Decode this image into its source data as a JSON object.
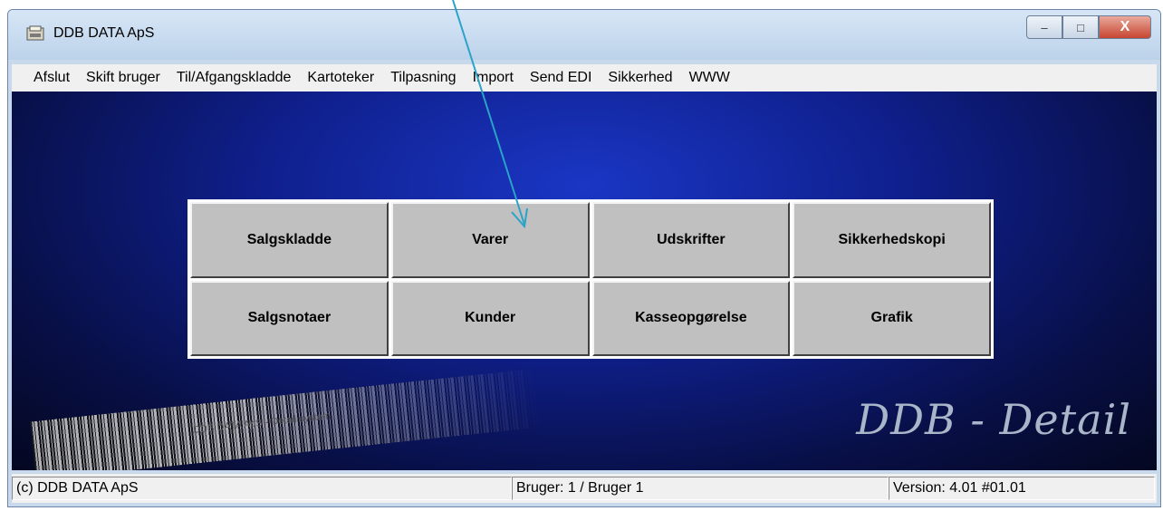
{
  "window": {
    "title": "DDB DATA ApS"
  },
  "window_buttons": {
    "minimize": "–",
    "maximize": "□",
    "close": "X"
  },
  "menu": [
    "Afslut",
    "Skift bruger",
    "Til/Afgangskladde",
    "Kartoteker",
    "Tilpasning",
    "Import",
    "Send EDI",
    "Sikkerhed",
    "WWW"
  ],
  "buttons": {
    "row1": [
      "Salgskladde",
      "Varer",
      "Udskrifter",
      "Sikkerhedskopi"
    ],
    "row2": [
      "Salgsnotaer",
      "Kunder",
      "Kasseopgørelse",
      "Grafik"
    ]
  },
  "barcode_caption": "DDB DATA ApS - Detail system",
  "logo": "DDB - Detail",
  "status": {
    "copyright": "(c) DDB DATA ApS",
    "user": "Bruger: 1 / Bruger 1",
    "version": "Version: 4.01 #01.01"
  },
  "colors": {
    "annotation_arrow": "#2aa3c8",
    "background_top": "#1a36c4",
    "background_bottom": "#040720"
  }
}
